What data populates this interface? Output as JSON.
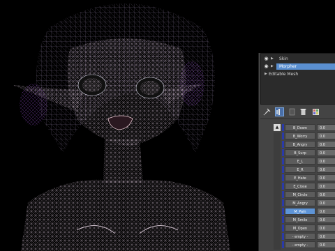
{
  "stack": {
    "items": [
      {
        "label": "Skin",
        "eye": "◉",
        "arrow": "▶",
        "selected": false
      },
      {
        "label": "Morpher",
        "eye": "◉",
        "arrow": "▶",
        "selected": true
      },
      {
        "label": "Editable Mesh",
        "eye": "",
        "arrow": "▶",
        "selected": false
      }
    ]
  },
  "toolbar": {
    "pin_icon": "pin-icon",
    "show_end_icon": "show-end-result-icon",
    "make_unique_icon": "make-unique-icon",
    "remove_icon": "trash-icon",
    "configure_icon": "configure-sets-icon"
  },
  "channels": [
    {
      "name": "B_Down",
      "value": "0.0",
      "selected": false
    },
    {
      "name": "B_Worry",
      "value": "0.0",
      "selected": false
    },
    {
      "name": "B_Angry",
      "value": "0.0",
      "selected": false
    },
    {
      "name": "B_Surp",
      "value": "0.0",
      "selected": false
    },
    {
      "name": "E_L",
      "value": "0.0",
      "selected": false
    },
    {
      "name": "E_R",
      "value": "0.0",
      "selected": false
    },
    {
      "name": "E_Hate",
      "value": "0.0",
      "selected": false
    },
    {
      "name": "E_Close",
      "value": "0.0",
      "selected": false
    },
    {
      "name": "M_Circle",
      "value": "0.0",
      "selected": false
    },
    {
      "name": "M_Angry",
      "value": "0.0",
      "selected": false
    },
    {
      "name": "M_Pain",
      "value": "0.0",
      "selected": true
    },
    {
      "name": "M_Smile",
      "value": "0.0",
      "selected": false
    },
    {
      "name": "M_Open",
      "value": "0.0",
      "selected": false
    },
    {
      "name": "- empty -",
      "value": "0.0",
      "selected": false
    },
    {
      "name": "- empty -",
      "value": "0.0",
      "selected": false
    }
  ],
  "scroll_up_label": "▲"
}
